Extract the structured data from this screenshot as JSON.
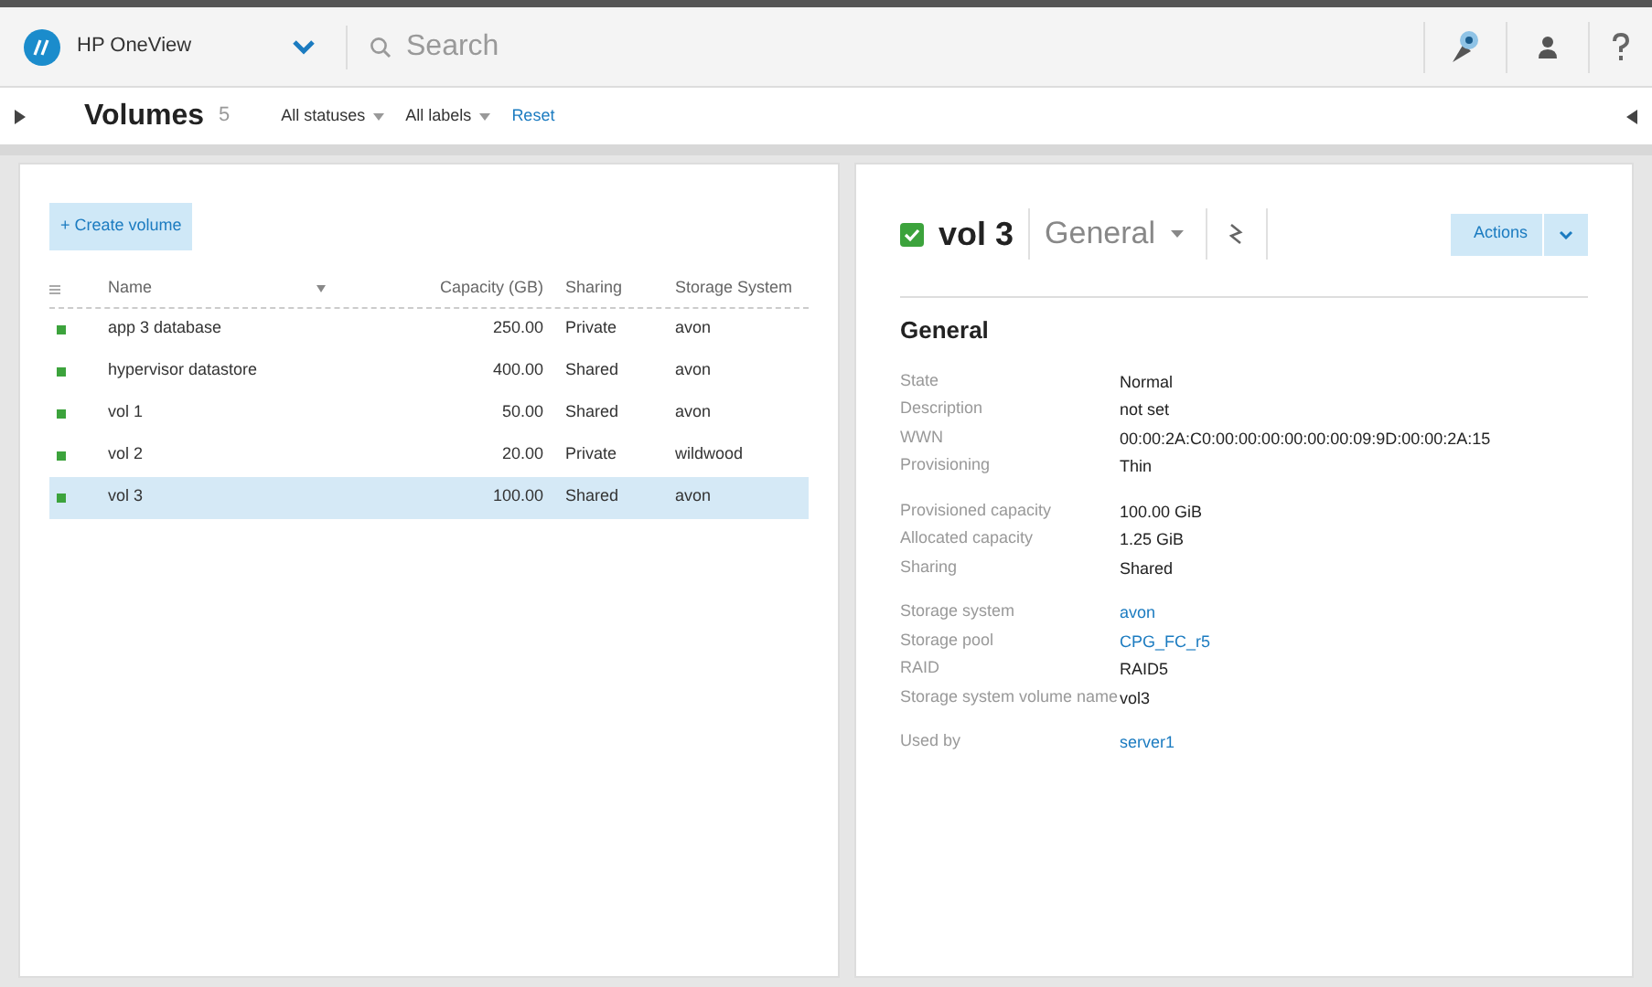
{
  "app": {
    "name": "HP OneView",
    "search_placeholder": "Search"
  },
  "page": {
    "title": "Volumes",
    "count": "5",
    "filters": [
      "All statuses",
      "All labels"
    ],
    "reset": "Reset"
  },
  "create_button": "+ Create volume",
  "table": {
    "columns": [
      "Name",
      "Capacity (GB)",
      "Sharing",
      "Storage System"
    ],
    "rows": [
      {
        "color": "#3ca33c",
        "cells": [
          "app 3 database",
          "250.00",
          "Private",
          "avon"
        ],
        "selected": false
      },
      {
        "color": "#3ca33c",
        "cells": [
          "hypervisor datastore",
          "400.00",
          "Shared",
          "avon"
        ],
        "selected": false
      },
      {
        "color": "#3ca33c",
        "cells": [
          "vol 1",
          "50.00",
          "Shared",
          "avon"
        ],
        "selected": false
      },
      {
        "color": "#3ca33c",
        "cells": [
          "vol 2",
          "20.00",
          "Private",
          "wildwood"
        ],
        "selected": false
      },
      {
        "color": "#3ca33c",
        "cells": [
          "vol 3",
          "100.00",
          "Shared",
          "avon"
        ],
        "selected": true
      }
    ]
  },
  "details": {
    "color": "#3ca33c",
    "title": "vol 3",
    "view": "General",
    "actions": "Actions",
    "section": "General",
    "groups": [
      [
        {
          "label": "State",
          "value": "Normal",
          "link": false
        },
        {
          "label": "Description",
          "value": "not set",
          "link": false
        },
        {
          "label": "WWN",
          "value": "00:00:2A:C0:00:00:00:00:00:00:09:9D:00:00:2A:15",
          "link": false
        },
        {
          "label": "Provisioning",
          "value": "Thin",
          "link": false
        }
      ],
      [
        {
          "label": "Provisioned capacity",
          "value": "100.00 GiB",
          "link": false
        },
        {
          "label": "Allocated capacity",
          "value": "1.25 GiB",
          "link": false
        },
        {
          "label": "Sharing",
          "value": "Shared",
          "link": false
        }
      ],
      [
        {
          "label": "Storage system",
          "value": "avon",
          "link": true
        },
        {
          "label": "Storage pool",
          "value": "CPG_FC_r5",
          "link": true
        },
        {
          "label": "RAID",
          "value": "RAID5",
          "link": false
        },
        {
          "label": "Storage system volume name",
          "value": "vol3",
          "link": false
        }
      ],
      [
        {
          "label": "Used by",
          "value": "server1",
          "link": true
        }
      ]
    ]
  }
}
